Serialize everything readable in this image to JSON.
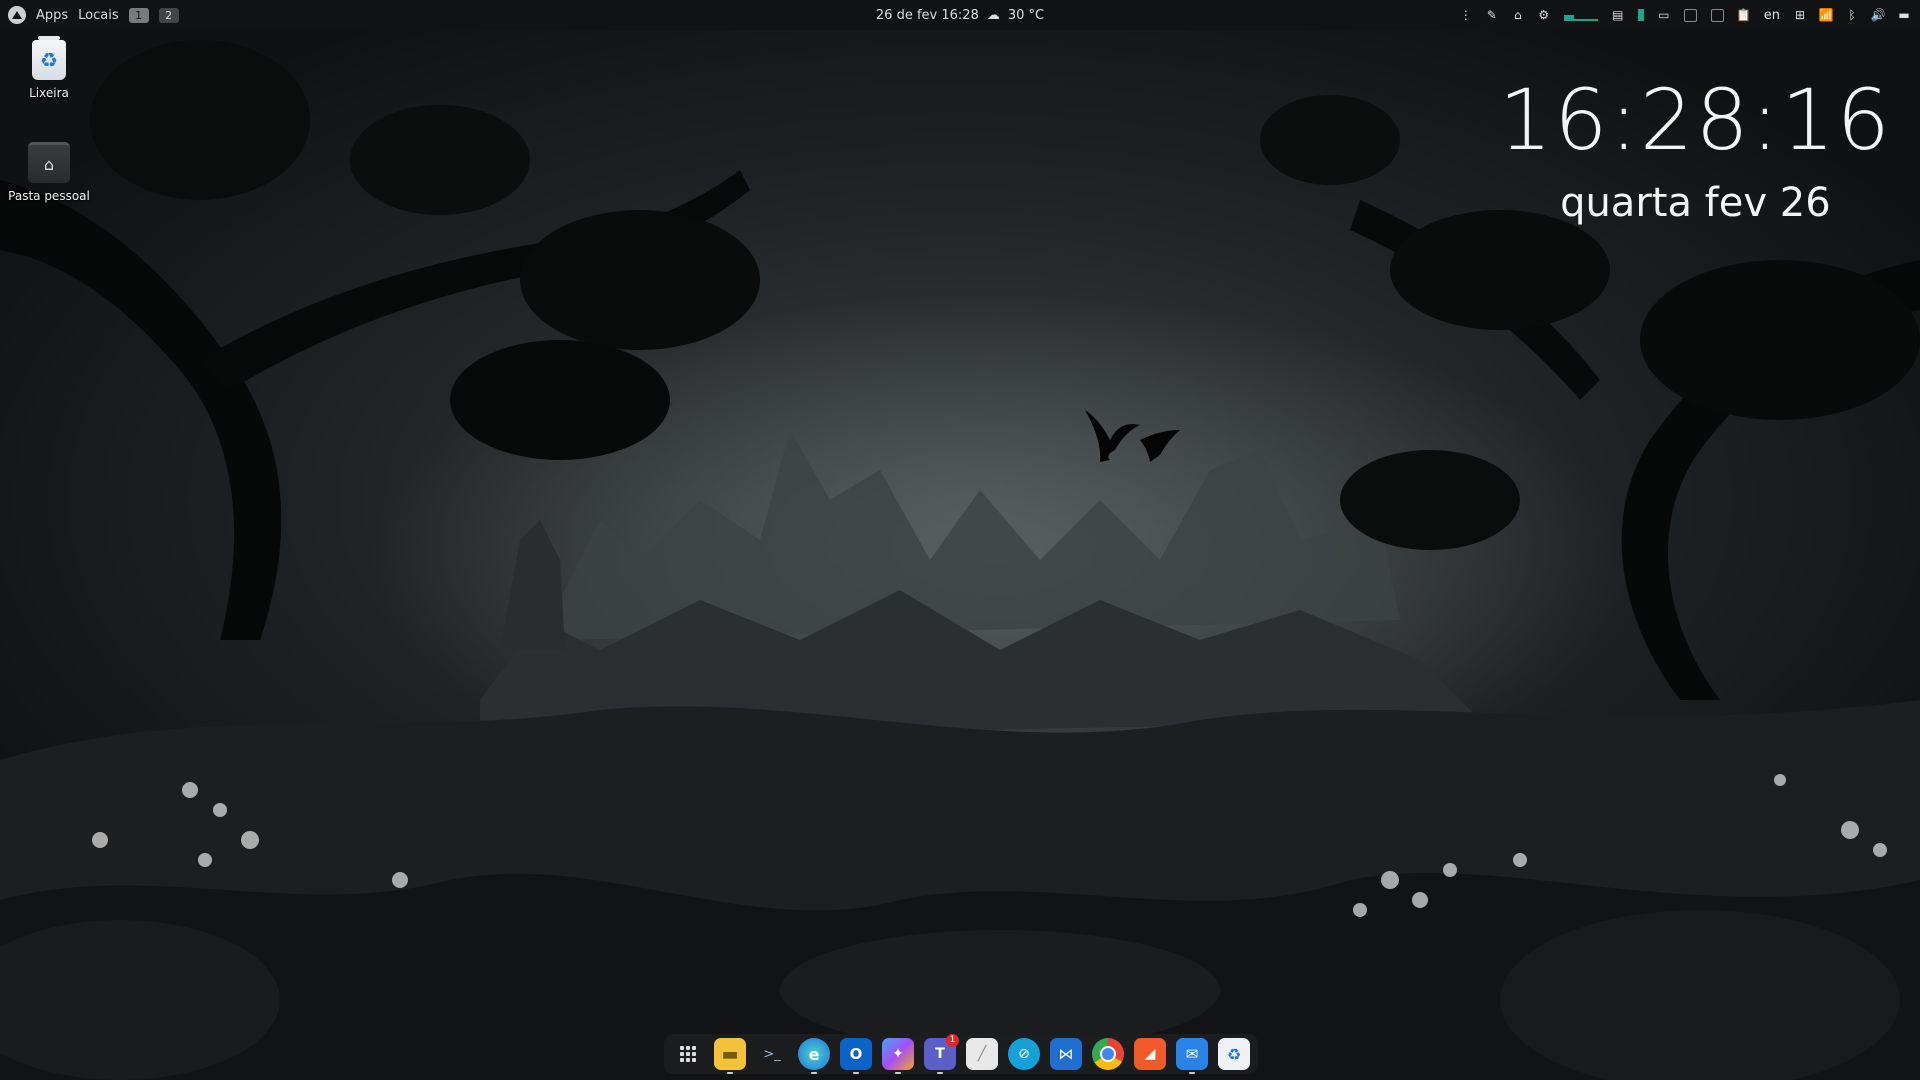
{
  "topbar": {
    "apps_label": "Apps",
    "places_label": "Locais",
    "workspaces": [
      "1",
      "2"
    ],
    "active_workspace": "1",
    "datetime": "26 de fev  16:28",
    "weather": "30 °C",
    "language": "en"
  },
  "desktop_icons": {
    "trash_label": "Lixeira",
    "home_label": "Pasta pessoal"
  },
  "clock_widget": {
    "time": "16:28:16",
    "date": "quarta fev 26"
  },
  "dock": {
    "apps": [
      {
        "name": "show-apps",
        "icon": "grid-icon"
      },
      {
        "name": "files",
        "icon": "folder-icon",
        "running": true
      },
      {
        "name": "terminal",
        "icon": "terminal-icon"
      },
      {
        "name": "edge",
        "icon": "edge-icon",
        "running": true
      },
      {
        "name": "outlook",
        "icon": "outlook-icon",
        "running": true
      },
      {
        "name": "copilot",
        "icon": "copilot-icon",
        "running": true
      },
      {
        "name": "teams",
        "icon": "teams-icon",
        "running": true,
        "badge": "1"
      },
      {
        "name": "text-editor",
        "icon": "notes-icon"
      },
      {
        "name": "app",
        "icon": "blue-circle-icon"
      },
      {
        "name": "vscode",
        "icon": "vscode-icon"
      },
      {
        "name": "chrome",
        "icon": "chrome-icon"
      },
      {
        "name": "app-orange",
        "icon": "orange-app-icon"
      },
      {
        "name": "mail",
        "icon": "mail-icon",
        "running": true
      },
      {
        "name": "trash",
        "icon": "trash-icon"
      }
    ]
  },
  "colors": {
    "accent": "#1da58f",
    "topbar_bg": "#111213",
    "badge": "#e02828"
  }
}
